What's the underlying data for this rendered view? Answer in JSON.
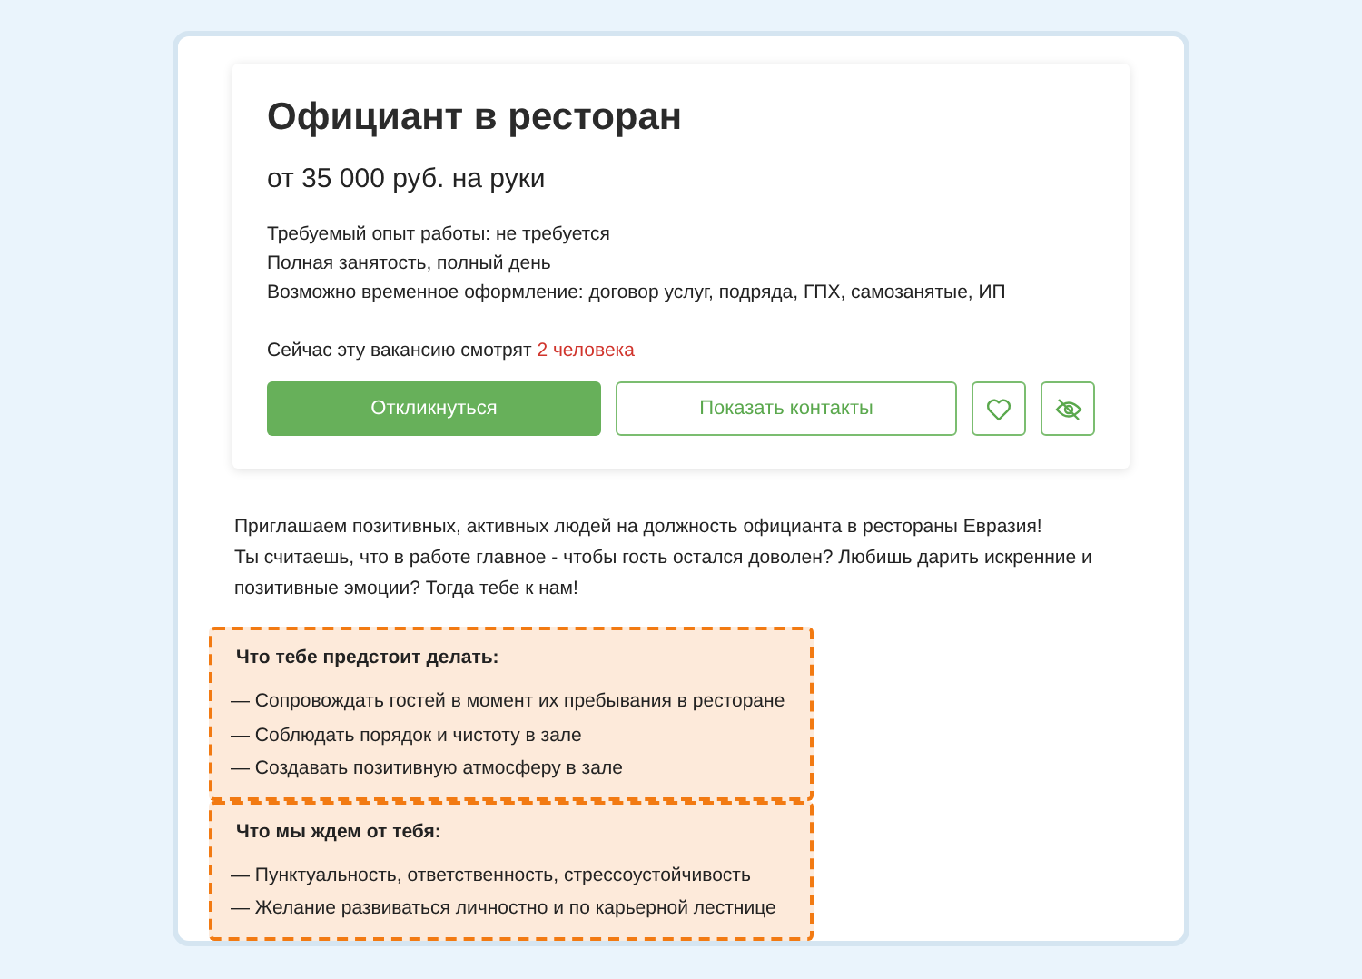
{
  "vacancy": {
    "title": "Официант в ресторан",
    "salary": "от 35 000 руб. на руки",
    "facts": [
      "Требуемый опыт работы: не требуется",
      "Полная занятость, полный день",
      "Возможно временное оформление: договор услуг, подряда, ГПХ, самозанятые, ИП"
    ],
    "viewers": {
      "text": "Сейчас эту вакансию смотрят",
      "count": "2 человека"
    },
    "buttons": [
      {
        "kind": "primary",
        "label": "Откликнуться"
      },
      {
        "kind": "outline",
        "label": "Показать контакты"
      },
      {
        "kind": "favorite"
      },
      {
        "kind": "hide"
      }
    ]
  },
  "description": [
    "Приглашаем позитивных, активных людей на должность официанта в рестораны Евразия!",
    "Ты считаешь, что в работе главное - чтобы гость остался доволен? Любишь дарить искренние и позитивные эмоции? Тогда тебе к нам!"
  ],
  "sections": [
    {
      "title": "Что тебе предстоит делать:",
      "highlighted": true,
      "items": [
        "— Сопровождать гостей в момент их пребывания в ресторане",
        "— Соблюдать порядок и чистоту в зале",
        "— Создавать позитивную атмосферу в зале"
      ]
    },
    {
      "title": "Что мы ждем от тебя:",
      "highlighted": true,
      "items": [
        "— Пунктуальность, ответственность, стрессоустойчивость",
        "— Желание развиваться личностно и по карьерной лестнице"
      ]
    }
  ]
}
